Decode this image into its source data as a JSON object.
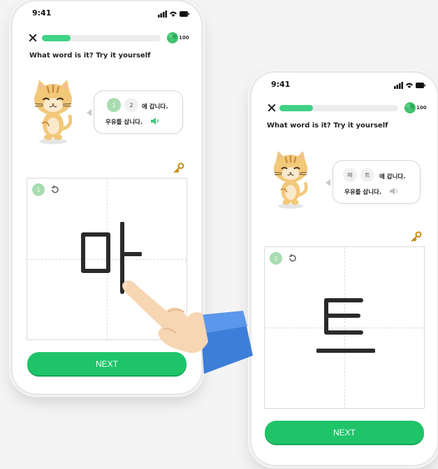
{
  "screens": [
    {
      "status_time": "9:41",
      "progress_fraction": 0.24,
      "gems": "100",
      "prompt": "What word is it? Try it yourself",
      "chips": [
        "1",
        "2"
      ],
      "active_chip": 0,
      "sentence_suffix": "에 갑니다.",
      "sentence_line2": "우유를 삽니다.",
      "step_number": "1",
      "character": "마",
      "next_label": "NEXT"
    },
    {
      "status_time": "9:41",
      "progress_fraction": 0.28,
      "gems": "100",
      "prompt": "What word is it? Try it yourself",
      "chips": [
        "마",
        "트"
      ],
      "active_chip": -1,
      "sentence_suffix": "에 갑니다.",
      "sentence_line2": "우유를 삽니다.",
      "step_number": "2",
      "character": "트",
      "next_label": "NEXT"
    }
  ],
  "colors": {
    "accent_green": "#1fc469",
    "progress_green": "#3fd286",
    "chip_active": "#a8dcb0",
    "hand_sleeve": "#3d7ed8",
    "hand_skin": "#f7d6b3"
  },
  "icons": [
    "close-icon",
    "gem-icon",
    "speaker-icon",
    "key-icon",
    "reset-icon",
    "cat-mascot",
    "pointing-hand"
  ]
}
